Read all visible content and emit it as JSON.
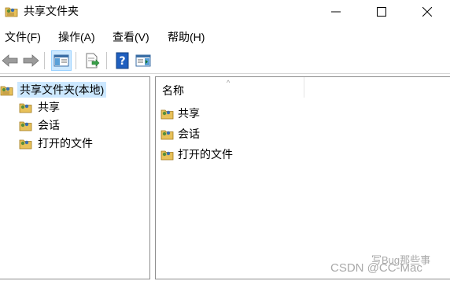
{
  "window": {
    "title": "共享文件夹"
  },
  "menu": {
    "file": "文件(F)",
    "action": "操作(A)",
    "view": "查看(V)",
    "help": "帮助(H)"
  },
  "toolbar": {
    "icons": [
      "back-arrow",
      "forward-arrow",
      "show-hide-console-tree",
      "export-list",
      "help-book",
      "show-hide-action-pane"
    ]
  },
  "tree": {
    "root": "共享文件夹(本地)",
    "items": [
      "共享",
      "会话",
      "打开的文件"
    ]
  },
  "list": {
    "column_name": "名称",
    "items": [
      "共享",
      "会话",
      "打开的文件"
    ]
  },
  "watermark": {
    "line": "CSDN @CC-Mac",
    "overlay": "写Bug那些事"
  },
  "colors": {
    "selection": "#cce8ff",
    "border": "#8e8e8e"
  }
}
